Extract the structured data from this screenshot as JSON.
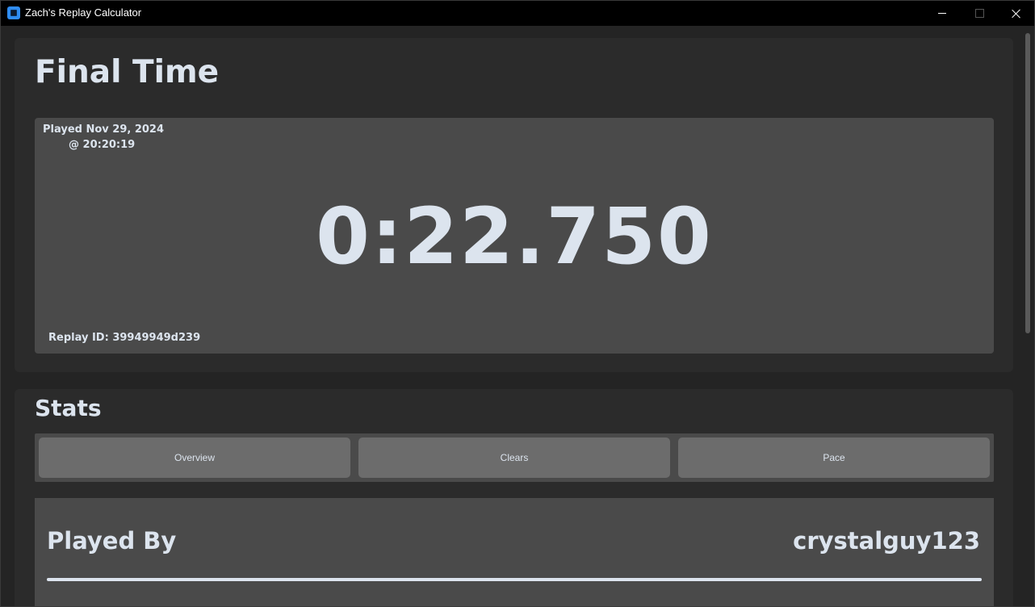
{
  "window": {
    "title": "Zach's Replay Calculator",
    "icon": "app-icon"
  },
  "final_time": {
    "heading": "Final Time",
    "played_date": "Played Nov 29, 2024",
    "played_time": "@ 20:20:19",
    "time": "0:22.750",
    "replay_id": "Replay ID: 39949949d239"
  },
  "stats": {
    "heading": "Stats",
    "tabs": [
      {
        "label": "Overview"
      },
      {
        "label": "Clears"
      },
      {
        "label": "Pace"
      }
    ],
    "played_by_label": "Played By",
    "played_by_value": "crystalguy123"
  },
  "colors": {
    "background": "#242424",
    "panel": "#4a4a4a",
    "card": "#2b2b2b",
    "button": "#6c6c6c",
    "text": "#dce4ee"
  }
}
